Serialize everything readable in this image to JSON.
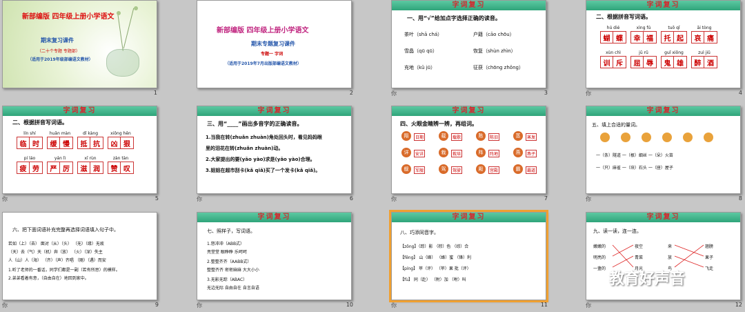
{
  "slides": [
    {
      "num": "1",
      "title": "新部编版  四年级上册小学语文",
      "sub": "期末复习课件",
      "tag": "（二十个专题 专题部）",
      "note": "（适用于2019年级部编语文教材）"
    },
    {
      "num": "2",
      "title": "新部编版  四年级上册小学语文",
      "sub": "期末专题复习课件",
      "topic": "专题一  字词",
      "note": "（适用于2019年7月出版部编语文教材）"
    },
    {
      "num": "3",
      "header": "字词复习",
      "q": "一、用“√”给加点字选择正确的读音。",
      "items": [
        "茶叶（shā  chá）",
        "户籍（cāo  chōu）",
        "雪晶（qū  qū）",
        "恢复（shùn  zhìn）",
        "充地（kǔ  jū）",
        "征获（chōng  zhǒng）"
      ],
      "note": "你"
    },
    {
      "num": "4",
      "header": "字词复习",
      "q": "二、根据拼音写词语。",
      "row1": [
        {
          "py": "hú  dié",
          "w": [
            "蝴",
            "蝶"
          ]
        },
        {
          "py": "xìng  fú",
          "w": [
            "幸",
            "福"
          ]
        },
        {
          "py": "tuō  qǐ",
          "w": [
            "托",
            "起"
          ]
        },
        {
          "py": "āi  tòng",
          "w": [
            "哀",
            "痛"
          ]
        }
      ],
      "row2": [
        {
          "py": "xùn  chì",
          "w": [
            "训",
            "斥"
          ]
        },
        {
          "py": "jū  rǔ",
          "w": [
            "屈",
            "辱"
          ]
        },
        {
          "py": "guǐ  xiōng",
          "w": [
            "鬼",
            "雄"
          ]
        },
        {
          "py": "zuì  jiǔ",
          "w": [
            "醉",
            "酒"
          ]
        }
      ],
      "note": "你"
    },
    {
      "num": "5",
      "header": "字词复习",
      "q": "二、根据拼音写词语。",
      "row1": [
        {
          "py": "lín  shí",
          "w": [
            "临",
            "时"
          ]
        },
        {
          "py": "huǎn  màn",
          "w": [
            "缓",
            "慢"
          ]
        },
        {
          "py": "dǐ  kàng",
          "w": [
            "抵",
            "抗"
          ]
        },
        {
          "py": "xiōng  hěn",
          "w": [
            "凶",
            "狠"
          ]
        }
      ],
      "row2": [
        {
          "py": "pí  láo",
          "w": [
            "疲",
            "劳"
          ]
        },
        {
          "py": "yán  lì",
          "w": [
            "严",
            "厉"
          ]
        },
        {
          "py": "xī  rùn",
          "w": [
            "滋",
            "润"
          ]
        },
        {
          "py": "zàn  tàn",
          "w": [
            "赞",
            "叹"
          ]
        }
      ],
      "note": "你"
    },
    {
      "num": "6",
      "header": "字词复习",
      "q": "三、用“____”画出多音字的正确读音。",
      "lines": [
        "1.当我在转(zhuǎn zhuàn)角处回头时，看见妈妈眼",
        "  里的泪花在转(zhuǎn zhuàn)动。",
        "2.大家提出的要(yāo yào)求是(yāo yào)合理。",
        "3.姐姐在超市刮卡(kǎ qiǎ)买了一个发卡(kǎ qiǎ)。"
      ],
      "note": "你"
    },
    {
      "num": "7",
      "header": "字词复习",
      "q": "四、火眼金睛辨一辨，再组词。",
      "tiles": [
        "翔",
        "载",
        "陈",
        "蒸",
        "详",
        "栽",
        "阵",
        "燕",
        "舰",
        "驾",
        "殿",
        "霸"
      ],
      "words": [
        "日期",
        "载歌",
        "陈旧",
        "蒸发",
        "安详",
        "栽培",
        "阵地",
        "燕子",
        "军舰",
        "驾驶",
        "宫殿",
        "霸道"
      ],
      "note": "你"
    },
    {
      "num": "8",
      "header": "字词复习",
      "q": "五、填上合适的量词。",
      "lines": [
        "一（条）隧道    一（根）细丝    一（朵）火苗",
        "一（只）麻雀    一（块）石头    一（座）屋子"
      ],
      "note": "你"
    },
    {
      "num": "9",
      "q": "六、把下面词语补充完整再选择词语填入句子中。",
      "lines": [
        "若如（上）（去）    面对（从）（头）    （无）（缘）无故",
        "（天）去（气）天（机）奔（放）    （火）（深）失主",
        "人（山）人（海）    （齐）（声）齐唱    （随）（遇）而安",
        "1.听了老师的一番话，同学们都是一副（若有所思）的模样。",
        "2.弟弟看着有意，（自由自在）地回到家中。"
      ],
      "note": "你"
    },
    {
      "num": "10",
      "header": "字词复习",
      "q": "七、照样子，写词语。",
      "lines": [
        "1.怒冲冲（ABB式）",
        "   亮堂堂   眼睁睁   乐呵呵",
        "2.整整齐齐（AABB式）",
        "   整整齐齐   密密麻麻   大大小小",
        "3.无影无踪（ABAC）",
        "   无边无际   自由自在   自言自语"
      ],
      "note": "你"
    },
    {
      "num": "11",
      "header": "字词复习",
      "q": "八、巧添同音字。",
      "lines": [
        "【zōng】（踪）影    （棕）色    （综）合",
        "【fēng】  山（峰）    （蜂）蜜    （锋）利",
        "【píng】  苹（评）    （苹）果    批（评）",
        "【fù】     同（赴）    （附）加    （咐）叫"
      ],
      "note": "你"
    },
    {
      "num": "12",
      "header": "字词复习",
      "q": "九、读一读，连一连。",
      "left": [
        "嫩嫩的",
        "明亮的",
        "一盏的"
      ],
      "mid": [
        "夜空",
        "青菜",
        "月光"
      ],
      "right1": [
        "来",
        "放",
        "鸟"
      ],
      "right2": [
        "翘膀",
        "果子",
        "飞走"
      ],
      "note": "你"
    }
  ],
  "watermark": "教育好声音",
  "colors": {
    "header": "#2fa47a",
    "title_red": "#d7262d",
    "pink": "#c0247f"
  }
}
